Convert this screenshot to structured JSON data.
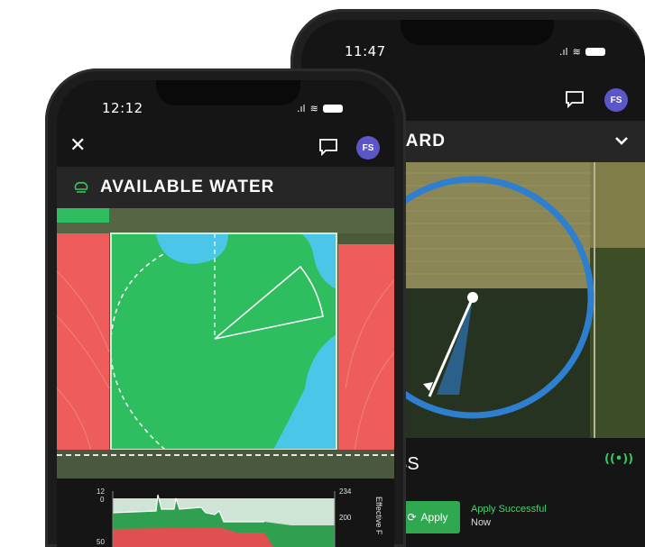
{
  "back_phone": {
    "status_time": "11:47",
    "avatar_initials": "FS",
    "header_title": "OARD",
    "section_title": "SS",
    "apply_button_label": "Apply",
    "apply_status": "Apply Successful",
    "apply_status_time": "Now"
  },
  "front_phone": {
    "status_time": "12:12",
    "avatar_initials": "FS",
    "header_title": "AVAILABLE WATER",
    "chart_left_ticks": [
      "12",
      "0",
      "50"
    ],
    "chart_right_ticks": [
      "234",
      "200"
    ],
    "chart_right_axis_label": "Effective F"
  },
  "colors": {
    "field_green": "#2ebd5f",
    "water_blue": "#4cc6e8",
    "deficit_red": "#ef5c5c",
    "pivot_blue": "#2f7fd0",
    "accent_green": "#2fa84f"
  },
  "icons": [
    "close-icon",
    "chat-icon",
    "cloud-icon",
    "chevron-down-icon",
    "signal-icon",
    "wifi-icon",
    "battery-icon",
    "refresh-icon"
  ]
}
